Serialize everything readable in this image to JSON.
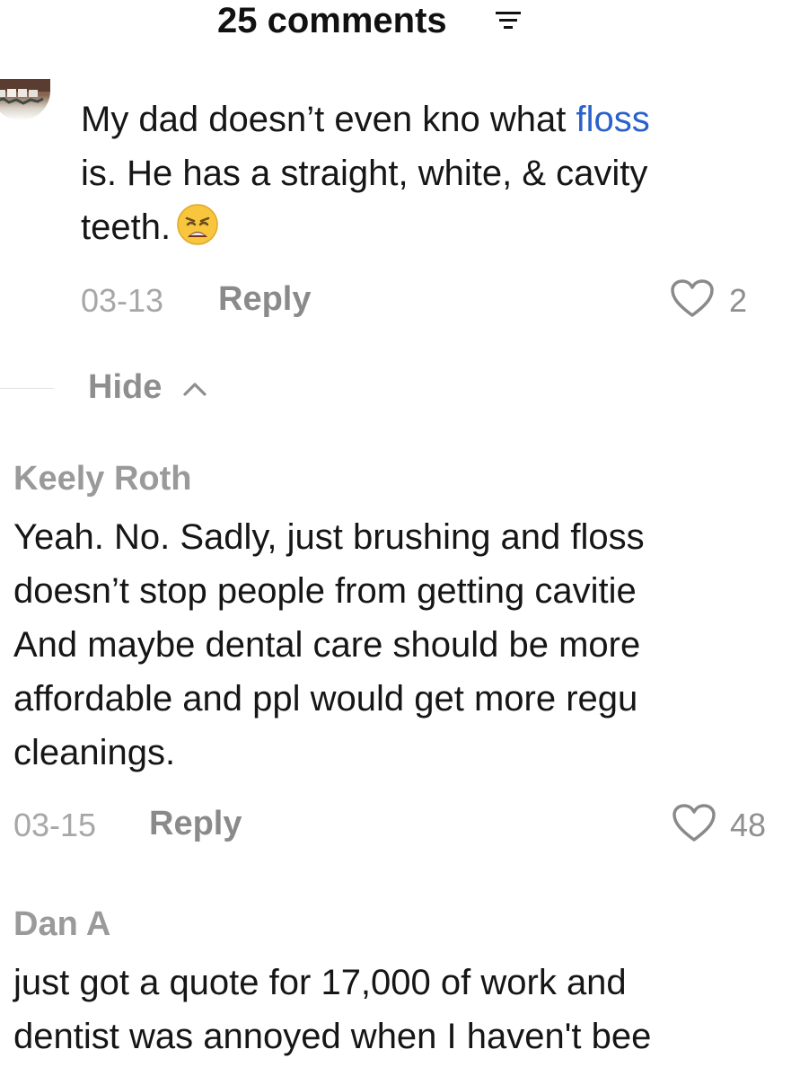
{
  "header": {
    "title": "25 comments",
    "sort_icon": "sort-lines-icon"
  },
  "comments": [
    {
      "username": "",
      "text_lines": [
        "My dad doesn’t even kno what ",
        "floss",
        "is. He has a straight, white, & cavity",
        "teeth."
      ],
      "emoji": "weary-face",
      "date": "03-13",
      "reply_label": "Reply",
      "likes": "2"
    },
    {
      "username": "Keely Roth",
      "text_lines": [
        "Yeah. No. Sadly, just brushing and floss",
        "doesn’t stop people from getting cavitie",
        "And maybe dental care should be more",
        "affordable and ppl would get more regu",
        "cleanings."
      ],
      "date": "03-15",
      "reply_label": "Reply",
      "likes": "48"
    },
    {
      "username": "Dan A",
      "text_lines": [
        "just got a quote for 17,000 of work and",
        "dentist was annoyed when I haven't bee"
      ]
    }
  ],
  "replies_toggle": {
    "label": "Hide"
  },
  "colors": {
    "link": "#2a62c9",
    "meta_gray": "#a7a7a7",
    "reply_gray": "#8a8a8a",
    "text": "#161616"
  }
}
